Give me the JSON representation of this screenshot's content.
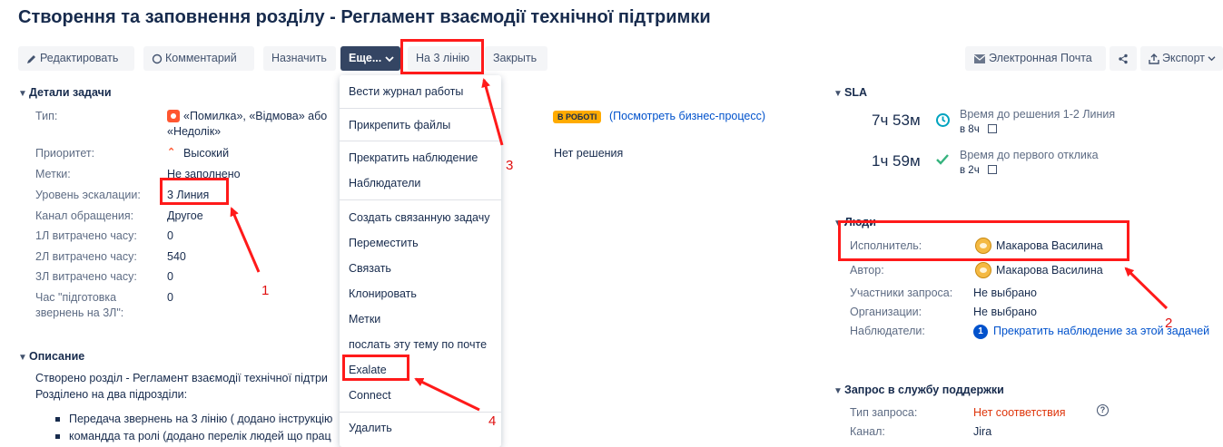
{
  "page": {
    "title": "Створення та заповнення розділу - Регламент взаємодії технічної підтримки"
  },
  "toolbar": {
    "edit": "Редактировать",
    "comment": "Комментарий",
    "assign": "Назначить",
    "more": "Еще...",
    "line3": "На 3 лінію",
    "close": "Закрыть",
    "email": "Электронная Почта",
    "export": "Экспорт"
  },
  "details": {
    "heading": "Детали задачи",
    "fields": [
      {
        "label": "Тип:",
        "value": "«Помилка», «Відмова» або"
      },
      {
        "label": "Приоритет:",
        "value": "Высокий"
      },
      {
        "label": "Метки:",
        "value": "Не заполнено"
      },
      {
        "label": "Уровень эскалации:",
        "value": "3 Линия"
      },
      {
        "label": "Канал обращения:",
        "value": "Другое"
      },
      {
        "label": "1Л витрачено часу:",
        "value": "0"
      },
      {
        "label": "2Л витрачено часу:",
        "value": "540"
      },
      {
        "label": "3Л витрачено часу:",
        "value": "0"
      },
      {
        "label": "Час \"підготовка",
        "value": "0"
      }
    ],
    "type_cont": "«Недолік»",
    "prep_cont": "звернень на 3Л\":",
    "status": "В РОБОТІ",
    "process_link": "(Посмотреть бизнес-процесс)",
    "resolution": "Нет решения"
  },
  "description": {
    "heading": "Описание",
    "lines": [
      "Створено розділ - Регламент взаємодії технічної підтри",
      "Розділено на два підрозділи:"
    ],
    "bullets": [
      "Передача звернень на 3 лінію ( додано інструкцію",
      "командда та ролі (додано перелік людей що прац"
    ]
  },
  "menu": {
    "items": [
      "Вести журнал работы",
      "Прикрепить файлы",
      "Прекратить наблюдение",
      "Наблюдатели",
      "Создать связанную задачу",
      "Переместить",
      "Связать",
      "Клонировать",
      "Метки",
      "послать эту тему по почте",
      "Exalate",
      "Connect",
      "Удалить"
    ]
  },
  "sla": {
    "heading": "SLA",
    "items": [
      {
        "time": "7ч 53м",
        "label": "Время до решения 1-2 Линия",
        "sub": "в 8ч"
      },
      {
        "time": "1ч 59м",
        "label": "Время до первого отклика",
        "sub": "в 2ч"
      }
    ]
  },
  "people": {
    "heading": "Люди",
    "assignee_label": "Исполнитель:",
    "assignee": "Макарова Василина",
    "author_label": "Автор:",
    "author": "Макарова Василина",
    "participants_label": "Участники запроса:",
    "participants": "Не выбрано",
    "orgs_label": "Организации:",
    "orgs": "Не выбрано",
    "watchers_label": "Наблюдатели:",
    "watchers_count": "1",
    "watchers_link": "Прекратить наблюдение за этой задачей"
  },
  "service": {
    "heading": "Запрос в службу поддержки",
    "type_label": "Тип запроса:",
    "type": "Нет соответствия",
    "channel_label": "Канал:",
    "channel": "Jira"
  },
  "annotations": {
    "n1": "1",
    "n2": "2",
    "n3": "3",
    "n4": "4"
  },
  "colors": {
    "accent": "#0052cc",
    "annotation": "#ff1a1a",
    "status": "#ffab00"
  }
}
